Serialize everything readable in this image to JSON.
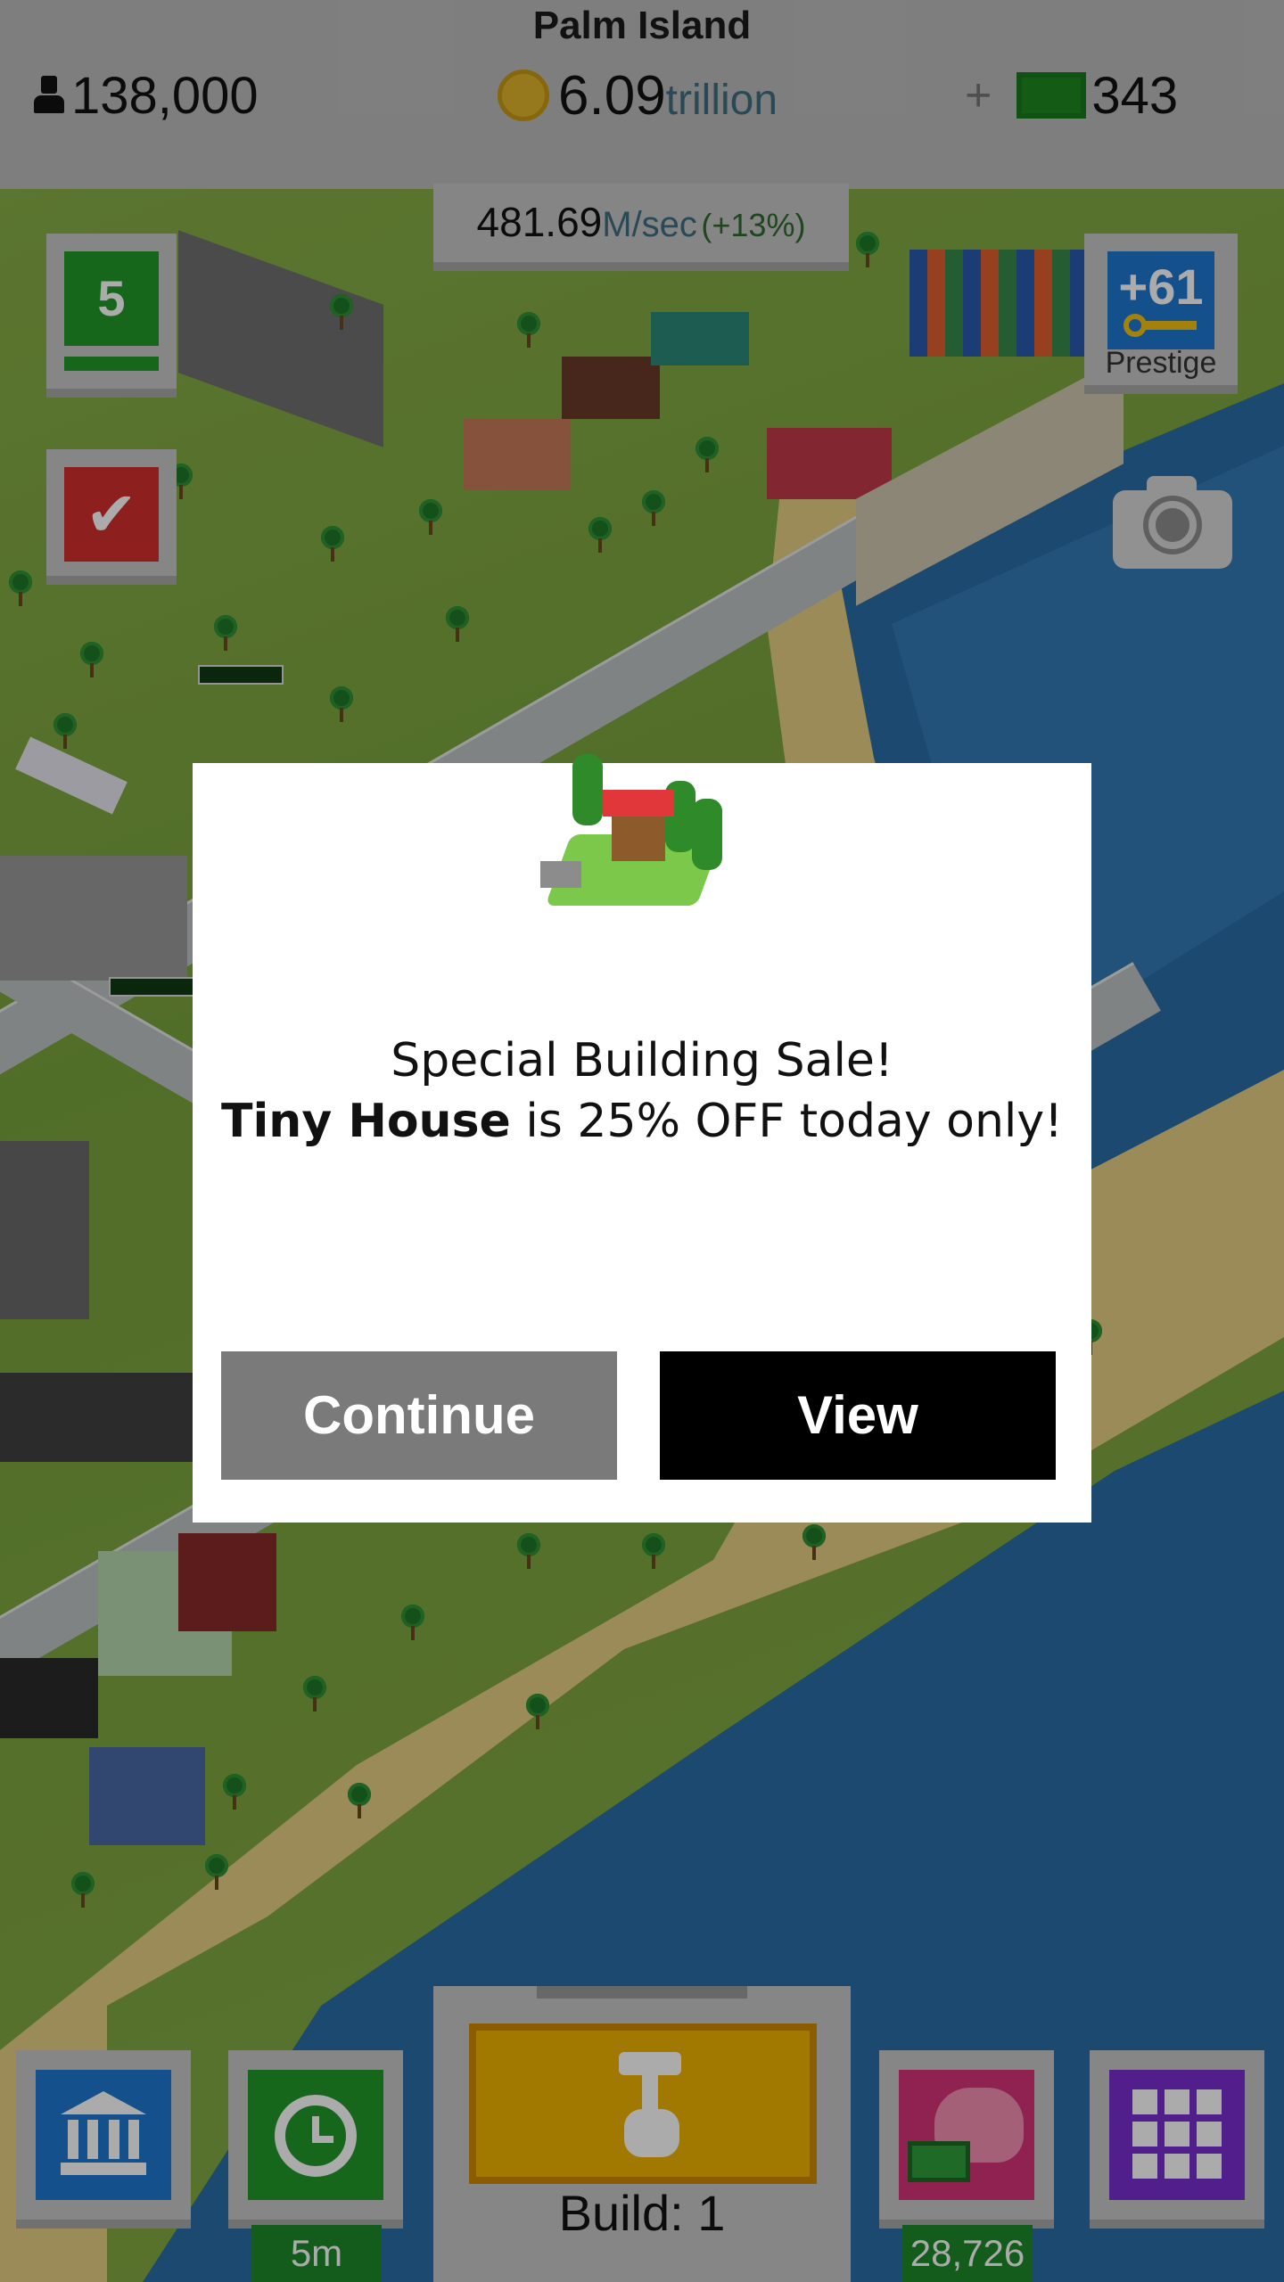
{
  "hud": {
    "city_name": "Palm Island",
    "population": "138,000",
    "money_value": "6.09",
    "money_unit": "trillion",
    "gems": "343",
    "income_value": "481.69",
    "income_unit": "M/sec",
    "income_bonus": "(+13%)"
  },
  "side": {
    "level": "5",
    "prestige_value": "+61",
    "prestige_label": "Prestige"
  },
  "bottom": {
    "timer_label": "5m",
    "build_label": "Build: 1",
    "piggy_value": "28,726"
  },
  "modal": {
    "line1": "Special Building Sale!",
    "building_name": "Tiny House",
    "line2_rest": " is 25% OFF today only!",
    "continue_label": "Continue",
    "view_label": "View"
  },
  "colors": {
    "hud_bg": "#bdbdbd",
    "level_green": "#22992a",
    "task_red": "#d32f2f",
    "prestige_blue": "#1f78d1",
    "build_yellow": "#f0b400",
    "piggy_pink": "#d6337a",
    "grid_purple": "#7a2fd0",
    "continue_gray": "#7a7a7a",
    "view_black": "#000000"
  }
}
